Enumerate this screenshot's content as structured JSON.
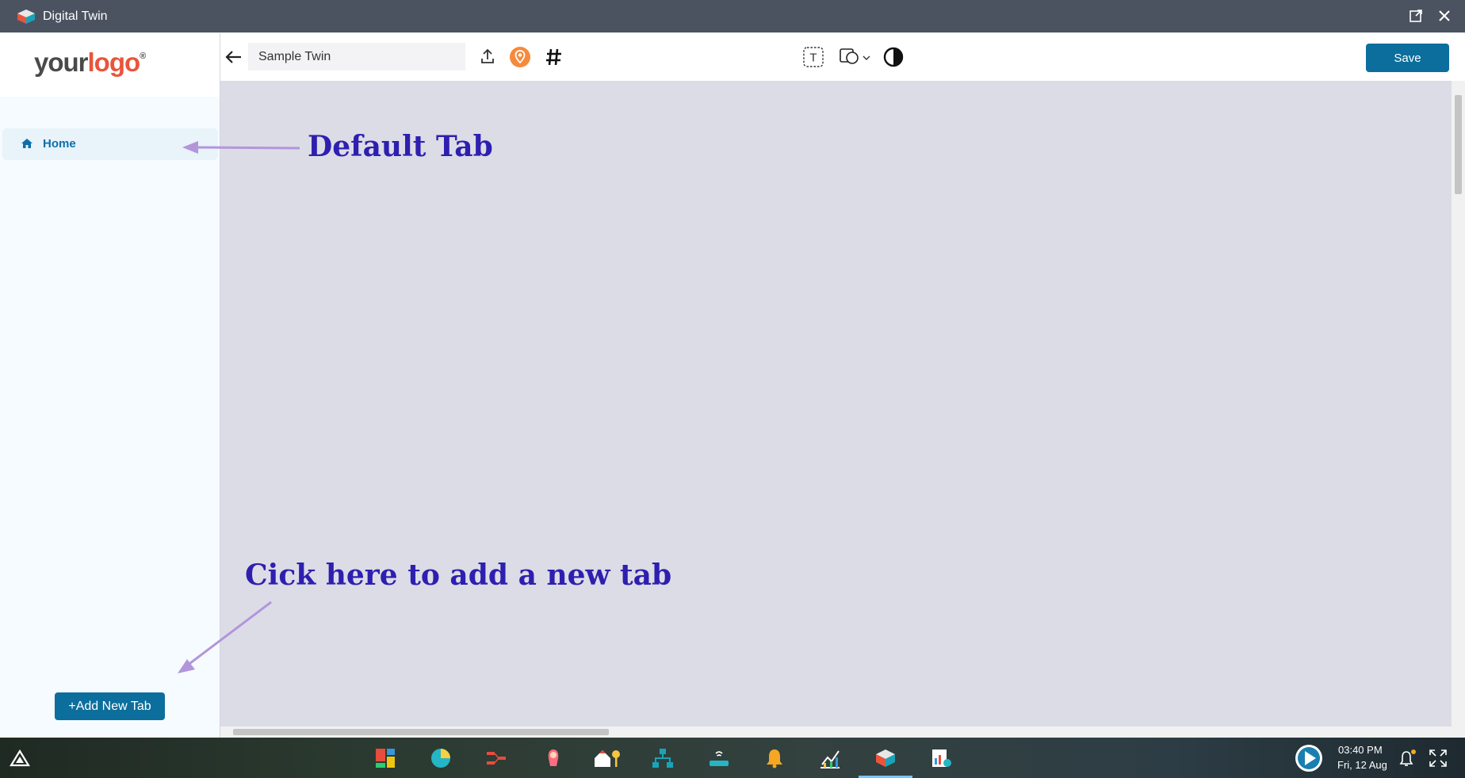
{
  "window": {
    "title": "Digital Twin"
  },
  "sidebar": {
    "logo_your": "your",
    "logo_logo": "logo",
    "logo_reg": "®",
    "items": [
      {
        "label": "Home",
        "icon": "home-icon"
      }
    ],
    "add_tab_label": "+Add New Tab"
  },
  "toolbar": {
    "twin_name": "Sample Twin",
    "text_tool_label": "T",
    "save_label": "Save"
  },
  "annotations": {
    "default_tab": "Default Tab",
    "add_tab_hint": "Cick here to add a new tab"
  },
  "taskbar": {
    "time": "03:40 PM",
    "date": "Fri, 12 Aug"
  },
  "colors": {
    "accent": "#0c6e9c",
    "annotation": "#2e1fb0",
    "arrow": "#b395dc",
    "canvas": "#dcdce6"
  }
}
